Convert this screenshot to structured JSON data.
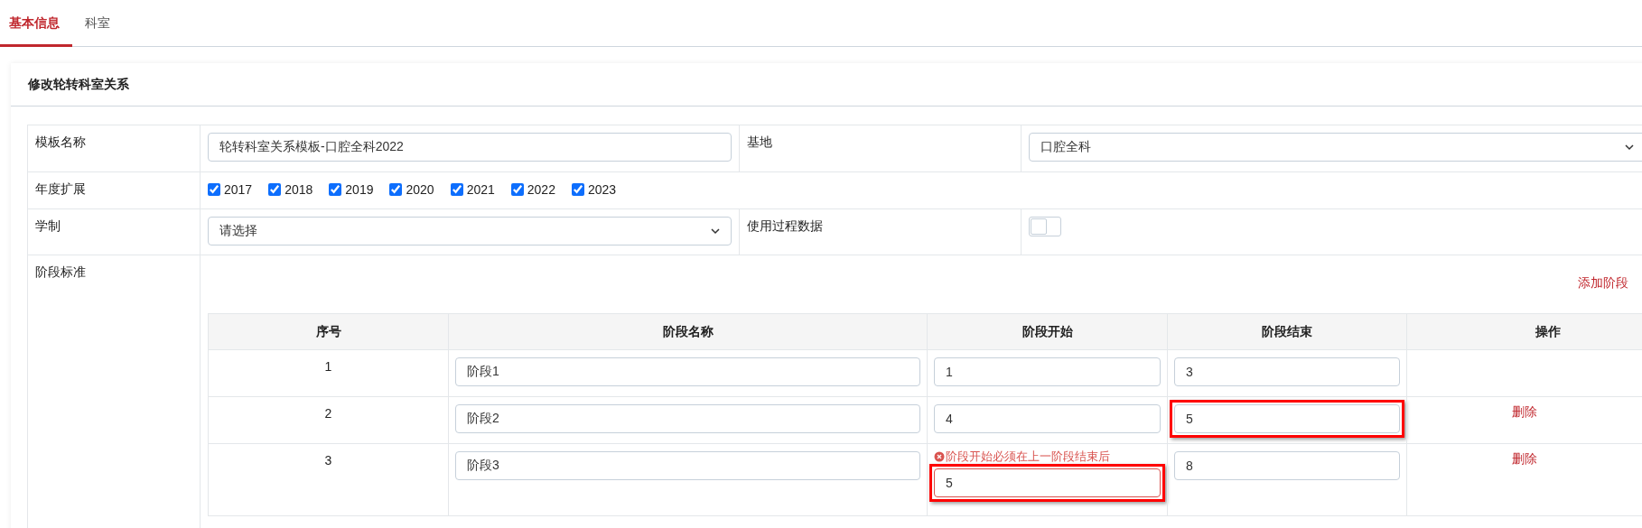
{
  "tabs": [
    {
      "label": "基本信息",
      "selected": true
    },
    {
      "label": "科室",
      "selected": false
    }
  ],
  "card": {
    "title": "修改轮转科室关系"
  },
  "form": {
    "template_name": {
      "label": "模板名称",
      "value": "轮转科室关系模板-口腔全科2022"
    },
    "base": {
      "label": "基地",
      "value": "口腔全科"
    },
    "years": {
      "label": "年度扩展",
      "options": [
        {
          "label": "2017",
          "checked": true
        },
        {
          "label": "2018",
          "checked": true
        },
        {
          "label": "2019",
          "checked": true
        },
        {
          "label": "2020",
          "checked": true
        },
        {
          "label": "2021",
          "checked": true
        },
        {
          "label": "2022",
          "checked": true
        },
        {
          "label": "2023",
          "checked": true
        }
      ]
    },
    "system": {
      "label": "学制",
      "value": "请选择"
    },
    "process_data": {
      "label": "使用过程数据",
      "on": false
    },
    "stages": {
      "label": "阶段标准",
      "add_link": "添加阶段",
      "columns": [
        "序号",
        "阶段名称",
        "阶段开始",
        "阶段结束",
        "操作"
      ],
      "rows": [
        {
          "index": "1",
          "name": "阶段1",
          "start": {
            "value": "1",
            "highlighted": false,
            "invalid": false
          },
          "end": {
            "value": "3",
            "highlighted": false
          }
        },
        {
          "index": "2",
          "name": "阶段2",
          "start": {
            "value": "4",
            "highlighted": false,
            "invalid": false
          },
          "end": {
            "value": "5",
            "highlighted": true
          },
          "action": "删除"
        },
        {
          "index": "3",
          "name": "阶段3",
          "start": {
            "value": "5",
            "highlighted": true,
            "invalid": true,
            "error": "阶段开始必须在上一阶段结束后"
          },
          "end": {
            "value": "8",
            "highlighted": false
          },
          "action": "删除"
        }
      ]
    }
  }
}
